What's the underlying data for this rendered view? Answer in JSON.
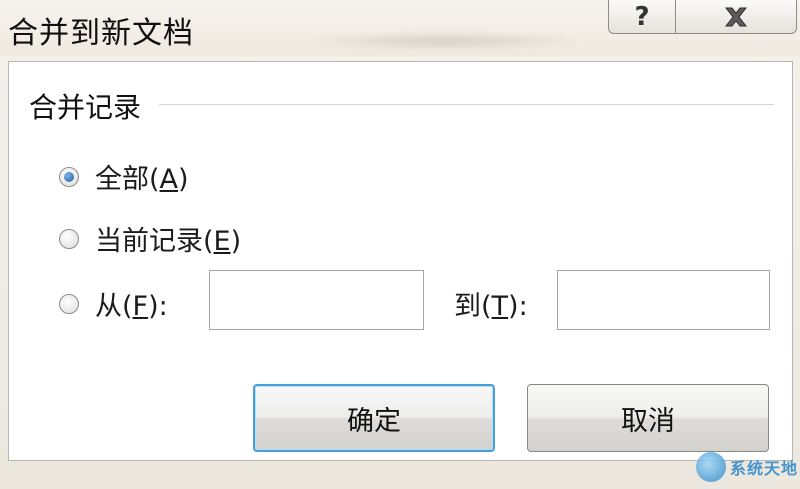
{
  "window": {
    "title": "合并到新文档",
    "help_glyph": "?",
    "close_icon": "close-icon"
  },
  "group": {
    "label": "合并记录"
  },
  "options": {
    "all": {
      "text": "全部(",
      "key": "A",
      "end": ")",
      "checked": true
    },
    "current": {
      "text": "当前记录(",
      "key": "E",
      "end": ")",
      "checked": false
    },
    "from": {
      "text": "从(",
      "key": "F",
      "end": "):",
      "checked": false
    }
  },
  "range": {
    "from_value": "",
    "to_text": "到(",
    "to_key": "T",
    "to_end": "):",
    "to_value": ""
  },
  "buttons": {
    "ok": "确定",
    "cancel": "取消"
  },
  "watermark": {
    "text": "系统天地"
  },
  "colors": {
    "focus_border": "#4c9ed8",
    "radio_selected": "#1c5fa8"
  }
}
